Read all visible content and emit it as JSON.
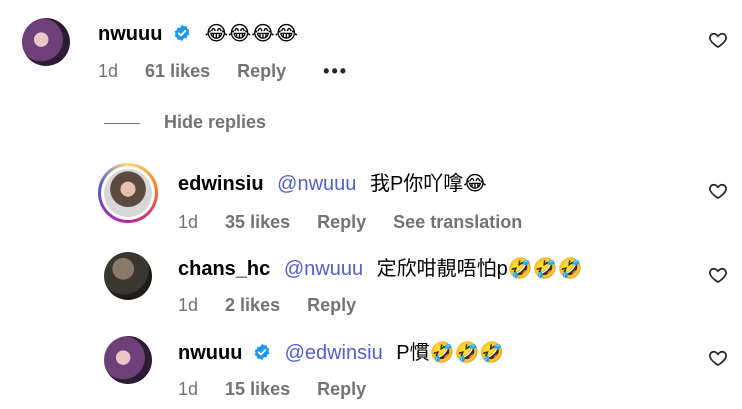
{
  "comments": [
    {
      "username": "nwuuu",
      "verified": true,
      "mention": "",
      "text": "",
      "emoji": "😂😂😂😂",
      "time": "1d",
      "likes": "61 likes",
      "reply": "Reply",
      "more": "•••",
      "see_translation": ""
    }
  ],
  "hide_replies": "Hide replies",
  "replies": [
    {
      "username": "edwinsiu",
      "verified": false,
      "mention": "@nwuuu",
      "text": "我P你吖嗱",
      "emoji": "😂",
      "time": "1d",
      "likes": "35 likes",
      "reply": "Reply",
      "see_translation": "See translation"
    },
    {
      "username": "chans_hc",
      "verified": false,
      "mention": "@nwuuu",
      "text": "定欣咁靚唔怕p",
      "emoji": "🤣🤣🤣",
      "time": "1d",
      "likes": "2 likes",
      "reply": "Reply",
      "see_translation": ""
    },
    {
      "username": "nwuuu",
      "verified": true,
      "mention": "@edwinsiu",
      "text": "P慣",
      "emoji": "🤣🤣🤣",
      "time": "1d",
      "likes": "15 likes",
      "reply": "Reply",
      "see_translation": ""
    }
  ],
  "colors": {
    "mention": "#4f5fd3",
    "meta": "#737373",
    "verified": "#1c96f0"
  },
  "icons": {
    "like": "heart-outline-icon",
    "verified": "verified-badge-icon",
    "more": "more-horizontal-icon"
  }
}
